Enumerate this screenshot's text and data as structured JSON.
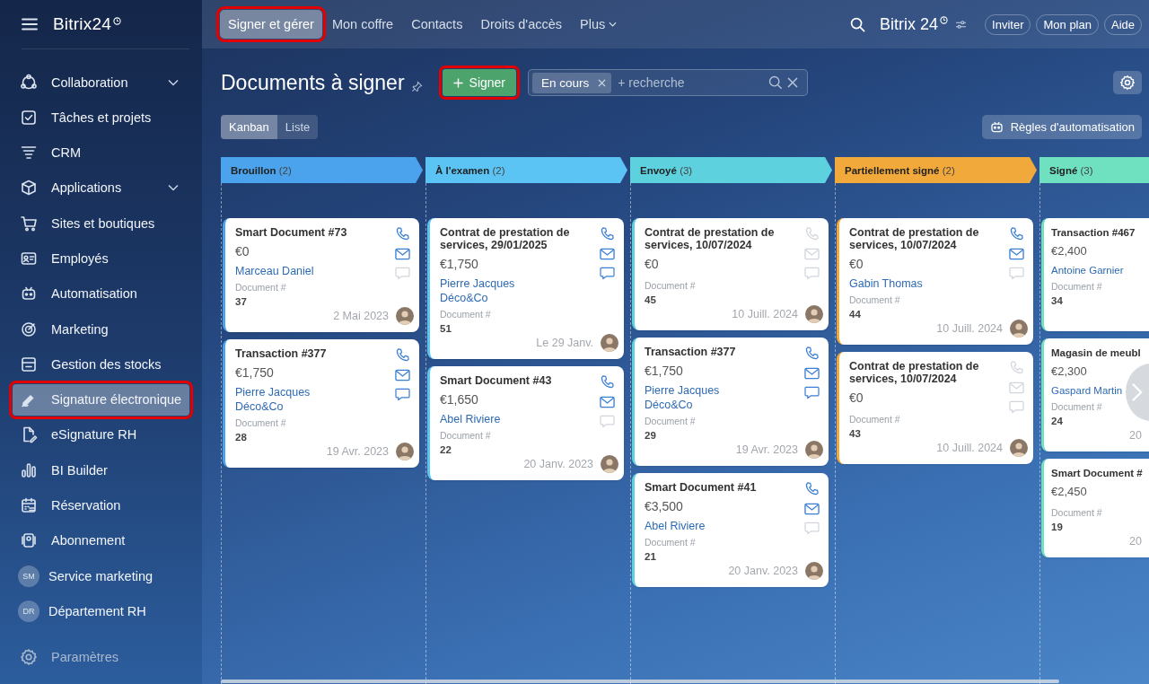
{
  "sidebar": {
    "logo": "Bitrix24",
    "items": [
      {
        "label": "Collaboration",
        "kind": "icon",
        "has_submenu": true,
        "selected": false,
        "highlighted": false
      },
      {
        "label": "Tâches et projets",
        "kind": "icon",
        "has_submenu": false,
        "selected": false,
        "highlighted": false
      },
      {
        "label": "CRM",
        "kind": "icon",
        "has_submenu": false,
        "selected": false,
        "highlighted": false
      },
      {
        "label": "Applications",
        "kind": "icon",
        "has_submenu": true,
        "selected": false,
        "highlighted": false
      },
      {
        "label": "Sites et boutiques",
        "kind": "icon",
        "has_submenu": false,
        "selected": false,
        "highlighted": false
      },
      {
        "label": "Employés",
        "kind": "icon",
        "has_submenu": false,
        "selected": false,
        "highlighted": false
      },
      {
        "label": "Automatisation",
        "kind": "icon",
        "has_submenu": false,
        "selected": false,
        "highlighted": false
      },
      {
        "label": "Marketing",
        "kind": "icon",
        "has_submenu": false,
        "selected": false,
        "highlighted": false
      },
      {
        "label": "Gestion des stocks",
        "kind": "icon",
        "has_submenu": false,
        "selected": false,
        "highlighted": false
      },
      {
        "label": "Signature électronique",
        "kind": "icon",
        "has_submenu": false,
        "selected": true,
        "highlighted": true
      },
      {
        "label": "eSignature RH",
        "kind": "icon",
        "has_submenu": false,
        "selected": false,
        "highlighted": false
      },
      {
        "label": "BI Builder",
        "kind": "icon",
        "has_submenu": false,
        "selected": false,
        "highlighted": false
      },
      {
        "label": "Réservation",
        "kind": "icon",
        "has_submenu": false,
        "selected": false,
        "highlighted": false
      },
      {
        "label": "Abonnement",
        "kind": "icon",
        "has_submenu": false,
        "selected": false,
        "highlighted": false
      },
      {
        "label": "Service marketing",
        "kind": "initials",
        "initials": "SM",
        "has_submenu": false,
        "selected": false,
        "highlighted": false
      },
      {
        "label": "Département RH",
        "kind": "initials",
        "initials": "DR",
        "has_submenu": false,
        "selected": false,
        "highlighted": false
      }
    ],
    "settings": "Paramètres"
  },
  "top_nav": {
    "tabs": [
      {
        "label": "Signer et gérer",
        "selected": true,
        "highlighted": true,
        "dropdown": false
      },
      {
        "label": "Mon coffre",
        "selected": false,
        "highlighted": false,
        "dropdown": false
      },
      {
        "label": "Contacts",
        "selected": false,
        "highlighted": false,
        "dropdown": false
      },
      {
        "label": "Droits d'accès",
        "selected": false,
        "highlighted": false,
        "dropdown": false
      },
      {
        "label": "Plus",
        "selected": false,
        "highlighted": false,
        "dropdown": true
      }
    ],
    "logo": {
      "name": "Bitrix",
      "suffix": "24"
    },
    "buttons": [
      "Inviter",
      "Mon plan",
      "Aide"
    ]
  },
  "toolbar": {
    "title": "Documents à signer",
    "add_button": {
      "label": "Signer",
      "highlighted": true
    },
    "filter": {
      "chip": "En cours",
      "placeholder": "+ recherche"
    },
    "views": [
      {
        "label": "Kanban",
        "selected": true
      },
      {
        "label": "Liste",
        "selected": false
      }
    ],
    "automation_button": "Règles d'automatisation"
  },
  "columns": [
    {
      "name": "Brouillon",
      "count": "(2)",
      "color": "#4aa3ec",
      "cards": [
        {
          "title": "Smart Document #73",
          "amount": "€0",
          "contacts": [
            "Marceau Daniel"
          ],
          "doc_label": "Document #",
          "doc_number": "37",
          "date": "2 Mai 2023",
          "avatar": true,
          "icons": {
            "phone": true,
            "mail": true,
            "chat": false
          }
        },
        {
          "title": "Transaction #377",
          "amount": "€1,750",
          "contacts": [
            "Pierre Jacques",
            "Déco&Co"
          ],
          "doc_label": "Document #",
          "doc_number": "28",
          "date": "19 Avr. 2023",
          "avatar": true,
          "icons": {
            "phone": true,
            "mail": true,
            "chat": true
          }
        }
      ]
    },
    {
      "name": "À l'examen",
      "count": "(2)",
      "color": "#5bc4f5",
      "cards": [
        {
          "title": "Contrat de prestation de services, 29/01/2025",
          "amount": "€1,750",
          "contacts": [
            "Pierre Jacques",
            "Déco&Co"
          ],
          "doc_label": "Document #",
          "doc_number": "51",
          "date": "Le 29 Janv.",
          "avatar": true,
          "icons": {
            "phone": true,
            "mail": true,
            "chat": true
          }
        },
        {
          "title": "Smart Document #43",
          "amount": "€1,650",
          "contacts": [
            "Abel Riviere"
          ],
          "doc_label": "Document #",
          "doc_number": "22",
          "date": "20 Janv. 2023",
          "avatar": true,
          "icons": {
            "phone": true,
            "mail": true,
            "chat": false
          }
        }
      ]
    },
    {
      "name": "Envoyé",
      "count": "(3)",
      "color": "#5ed1de",
      "cards": [
        {
          "title": "Contrat de prestation de services, 10/07/2024",
          "amount": "€0",
          "doc_label": "Document #",
          "doc_number": "45",
          "date": "10 Juill. 2024",
          "avatar": true,
          "icons": {
            "phone": false,
            "mail": false,
            "chat": false
          }
        },
        {
          "title": "Transaction #377",
          "amount": "€1,750",
          "contacts": [
            "Pierre Jacques",
            "Déco&Co"
          ],
          "doc_label": "Document #",
          "doc_number": "29",
          "date": "19 Avr. 2023",
          "avatar": true,
          "icons": {
            "phone": true,
            "mail": true,
            "chat": true
          }
        },
        {
          "title": "Smart Document #41",
          "amount": "€3,500",
          "contacts": [
            "Abel Riviere"
          ],
          "doc_label": "Document #",
          "doc_number": "21",
          "date": "20 Janv. 2023",
          "avatar": true,
          "icons": {
            "phone": true,
            "mail": true,
            "chat": false
          }
        }
      ]
    },
    {
      "name": "Partiellement signé",
      "count": "(2)",
      "color": "#f2a93b",
      "cards": [
        {
          "title": "Contrat de prestation de services, 10/07/2024",
          "amount": "€0",
          "contacts": [
            "Gabin Thomas"
          ],
          "doc_label": "Document #",
          "doc_number": "44",
          "date": "10 Juill. 2024",
          "avatar": true,
          "icons": {
            "phone": true,
            "mail": true,
            "chat": false
          }
        },
        {
          "title": "Contrat de prestation de services, 10/07/2024",
          "amount": "€0",
          "doc_label": "Document #",
          "doc_number": "43",
          "date": "10 Juill. 2024",
          "avatar": true,
          "icons": {
            "phone": false,
            "mail": false,
            "chat": false
          }
        }
      ]
    },
    {
      "name": "Signé",
      "count": "(3)",
      "color": "#6fe0c0",
      "cards": [
        {
          "title": "Transaction #467",
          "amount": "€2,400",
          "contacts": [
            "Antoine Garnier"
          ],
          "doc_label": "Document #",
          "doc_number": "34",
          "avatar": false
        },
        {
          "title": "Magasin de meubl",
          "amount": "€2,300",
          "contacts": [
            "Gaspard Martin"
          ],
          "doc_label": "Document #",
          "doc_number": "24",
          "date": "20",
          "avatar": false
        },
        {
          "title": "Smart Document #",
          "amount": "€2,450",
          "doc_label": "Document #",
          "doc_number": "19",
          "date": "20",
          "avatar": false
        }
      ]
    }
  ]
}
